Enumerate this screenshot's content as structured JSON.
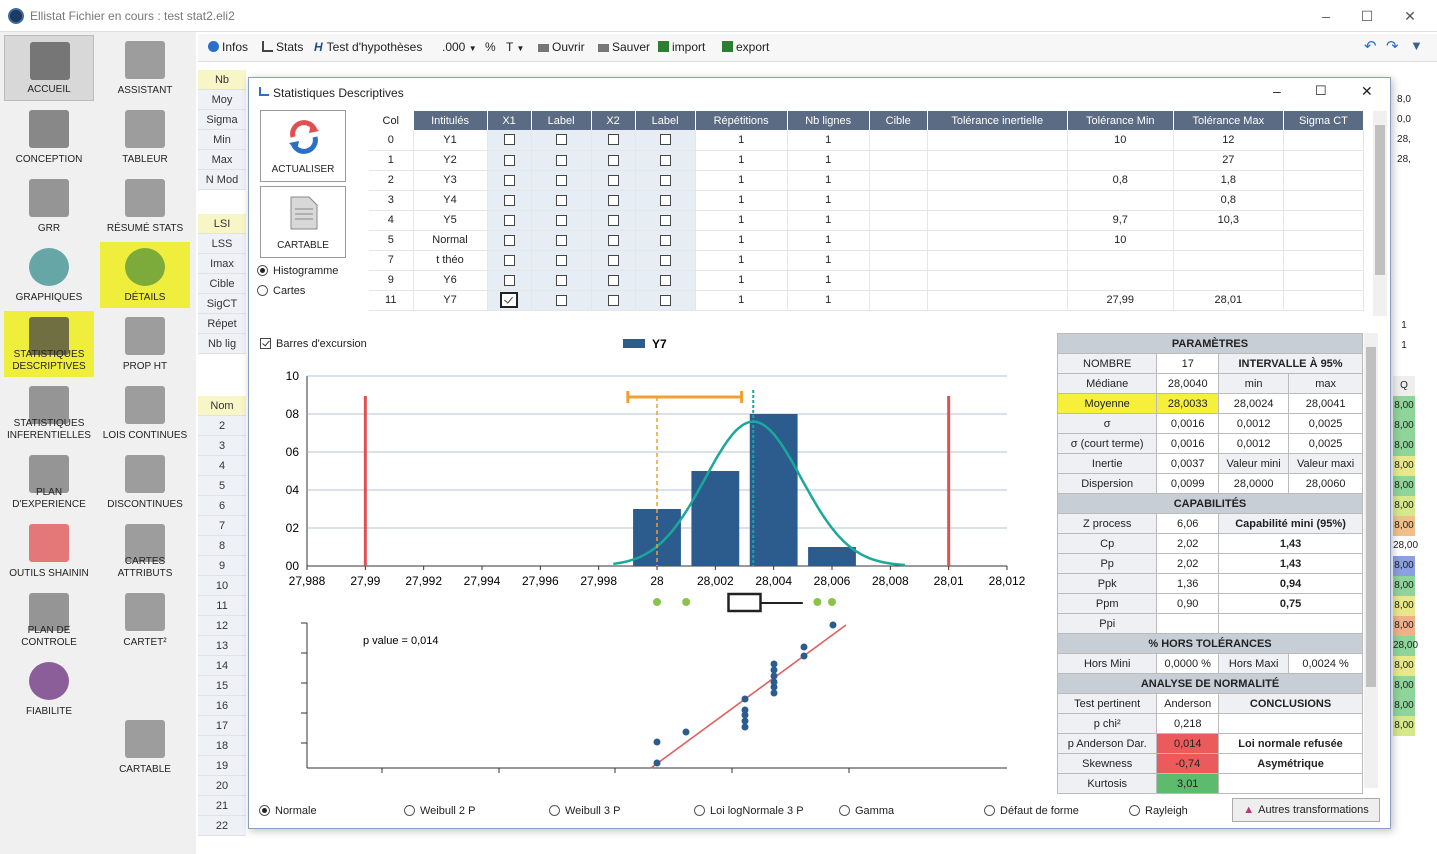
{
  "window": {
    "title": "Ellistat Fichier en cours : test stat2.eli2"
  },
  "sidebar": {
    "left": [
      {
        "label": "ACCUEIL",
        "icon": "home-icon"
      },
      {
        "label": "CONCEPTION",
        "icon": "conception-icon"
      },
      {
        "label": "GRR",
        "icon": "caliper-icon"
      },
      {
        "label": "GRAPHIQUES",
        "icon": "pie-chart-icon"
      },
      {
        "label": "STATISTIQUES DESCRIPTIVES",
        "icon": "bar-chart-icon"
      },
      {
        "label": "STATISTIQUES INFERENTIELLES",
        "icon": "cube-icon"
      },
      {
        "label": "PLAN D'EXPERIENCE",
        "icon": "hierarchy-icon"
      },
      {
        "label": "OUTILS SHAININ",
        "icon": "shainin-icon"
      },
      {
        "label": "PLAN DE CONTROLE",
        "icon": "control-plan-icon"
      },
      {
        "label": "FIABILITE",
        "icon": "check-icon"
      }
    ],
    "right": [
      {
        "label": "ASSISTANT",
        "icon": "question-icon"
      },
      {
        "label": "TABLEUR",
        "icon": "spreadsheet-icon"
      },
      {
        "label": "RÉSUMÉ STATS",
        "icon": "summary-icon"
      },
      {
        "label": "DÉTAILS",
        "icon": "magnifier-icon"
      },
      {
        "label": "PROP HT",
        "icon": "bell-curve-icon"
      },
      {
        "label": "LOIS CONTINUES",
        "icon": "distribution-icon"
      },
      {
        "label": "DISCONTINUES",
        "icon": "discrete-icon"
      },
      {
        "label": "CARTES ATTRIBUTS",
        "icon": "attributes-chart-icon"
      },
      {
        "label": "CARTET²",
        "icon": "control-chart-icon"
      },
      {
        "label": "CARTABLE",
        "icon": "document-icon"
      }
    ]
  },
  "toolbar": {
    "infos": "Infos",
    "stats": "Stats",
    "test": "Test d'hypothèses",
    "format": ".000",
    "percent": "%",
    "t": "T",
    "ouvrir": "Ouvrir",
    "sauver": "Sauver",
    "import": "import",
    "export": "export"
  },
  "sheet": {
    "row_headers_top": [
      "Nb",
      "Moy",
      "Sigma",
      "Min",
      "Max",
      "N Mod"
    ],
    "row_headers_mid": [
      "LSI",
      "LSS",
      "Imax",
      "Cible",
      "SigCT",
      "Répet",
      "Nb lig"
    ],
    "row_headers_nums": [
      "Nom",
      "2",
      "3",
      "4",
      "5",
      "6",
      "7",
      "8",
      "9",
      "10",
      "11",
      "12",
      "13",
      "14",
      "15",
      "16",
      "17",
      "18",
      "19",
      "20",
      "21",
      "22"
    ],
    "right_col_top": [
      "8,0",
      "0,0",
      "28,",
      "28,"
    ],
    "right_col_bottom": [
      "Q",
      "8,00",
      "8,00",
      "8,00",
      "8,00",
      "8,00",
      "8,00",
      "8,00",
      "28,00",
      "8,00",
      "8,00",
      "8,00",
      "8,00",
      "28,00",
      "8,00",
      "8,00",
      "8,00",
      "8,00"
    ],
    "right_col_mid": [
      "1",
      "1"
    ]
  },
  "dialog": {
    "title": "Statistiques Descriptives",
    "actualiser": "ACTUALISER",
    "cartable": "CARTABLE",
    "radio_histogramme": "Histogramme",
    "radio_cartes": "Cartes",
    "barres": "Barres d'excursion",
    "table": {
      "headers": [
        "Col",
        "Intitulés",
        "X1",
        "Label",
        "X2",
        "Label",
        "Répétitions",
        "Nb lignes",
        "Cible",
        "Tolérance inertielle",
        "Tolérance Min",
        "Tolérance Max",
        "Sigma CT"
      ],
      "rows": [
        {
          "col": "0",
          "name": "Y1",
          "rep": "1",
          "nb": "1",
          "tmin": "10",
          "tmax": "12",
          "x1": false
        },
        {
          "col": "1",
          "name": "Y2",
          "rep": "1",
          "nb": "1",
          "tmin": "",
          "tmax": "27",
          "x1": false
        },
        {
          "col": "2",
          "name": "Y3",
          "rep": "1",
          "nb": "1",
          "tmin": "0,8",
          "tmax": "1,8",
          "x1": false
        },
        {
          "col": "3",
          "name": "Y4",
          "rep": "1",
          "nb": "1",
          "tmin": "",
          "tmax": "0,8",
          "x1": false
        },
        {
          "col": "4",
          "name": "Y5",
          "rep": "1",
          "nb": "1",
          "tmin": "9,7",
          "tmax": "10,3",
          "x1": false
        },
        {
          "col": "5",
          "name": "Normal",
          "rep": "1",
          "nb": "1",
          "tmin": "10",
          "tmax": "",
          "x1": false
        },
        {
          "col": "7",
          "name": "t théo",
          "rep": "1",
          "nb": "1",
          "tmin": "",
          "tmax": "",
          "x1": false
        },
        {
          "col": "9",
          "name": "Y6",
          "rep": "1",
          "nb": "1",
          "tmin": "",
          "tmax": "",
          "x1": false
        },
        {
          "col": "11",
          "name": "Y7",
          "rep": "1",
          "nb": "1",
          "tmin": "27,99",
          "tmax": "28,01",
          "x1": true
        }
      ]
    },
    "distributions": [
      "Normale",
      "Weibull 2 P",
      "Weibull 3 P",
      "Loi logNormale 3 P",
      "Gamma",
      "Défaut de forme",
      "Rayleigh"
    ],
    "autres": "Autres transformations",
    "pvalue": "p value = 0,014"
  },
  "chart_data": {
    "type": "bar",
    "legend": "Y7",
    "x_ticks": [
      "27,988",
      "27,99",
      "27,992",
      "27,994",
      "27,996",
      "27,998",
      "28",
      "28,002",
      "28,004",
      "28,006",
      "28,008",
      "28,01",
      "28,012"
    ],
    "y_ticks": [
      "10",
      "08",
      "06",
      "04",
      "02",
      "00"
    ],
    "xlim": [
      27.988,
      28.012
    ],
    "ylim": [
      0,
      10
    ],
    "bins": [
      {
        "x": 28.0,
        "y": 3
      },
      {
        "x": 28.002,
        "y": 5
      },
      {
        "x": 28.004,
        "y": 8
      },
      {
        "x": 28.006,
        "y": 1
      }
    ],
    "tol_min": 27.99,
    "tol_max": 28.01,
    "mean": 28.0033,
    "excursion": [
      27.999,
      28.0029
    ],
    "colors": {
      "bar": "#2c5b8e",
      "curve": "#1aa89a",
      "limit": "#e05050",
      "excursion": "#f0a030",
      "dots": "#8bc34a"
    }
  },
  "params": {
    "parametres": "PARAMÈTRES",
    "nombre_lbl": "NOMBRE",
    "nombre": "17",
    "intervalle": "INTERVALLE À 95%",
    "mediane_lbl": "Médiane",
    "mediane": "28,0040",
    "min_lbl": "min",
    "max_lbl": "max",
    "moyenne_lbl": "Moyenne",
    "moyenne": "28,0033",
    "moy_min": "28,0024",
    "moy_max": "28,0041",
    "sigma_lbl": "σ",
    "sigma": "0,0016",
    "sigma_min": "0,0012",
    "sigma_max": "0,0025",
    "sigct_lbl": "σ (court terme)",
    "sigct": "0,0016",
    "sigct_min": "0,0012",
    "sigct_max": "0,0025",
    "inertie_lbl": "Inertie",
    "inertie": "0,0037",
    "valmin_lbl": "Valeur mini",
    "valmax_lbl": "Valeur maxi",
    "dispersion_lbl": "Dispersion",
    "dispersion": "0,0099",
    "valmin": "28,0000",
    "valmax": "28,0060",
    "capabilites": "CAPABILITÉS",
    "zprocess_lbl": "Z process",
    "zprocess": "6,06",
    "capmini": "Capabilité mini (95%)",
    "cp_lbl": "Cp",
    "cp": "2,02",
    "cp_min": "1,43",
    "pp_lbl": "Pp",
    "pp": "2,02",
    "pp_min": "1,43",
    "ppk_lbl": "Ppk",
    "ppk": "1,36",
    "ppk_min": "0,94",
    "ppm_lbl": "Ppm",
    "ppm": "0,90",
    "ppm_min": "0,75",
    "ppi_lbl": "Ppi",
    "hors": "% HORS TOLÉRANCES",
    "horsmini_lbl": "Hors Mini",
    "horsmini": "0,0000 %",
    "horsmaxi_lbl": "Hors Maxi",
    "horsmaxi": "0,0024 %",
    "normalite": "ANALYSE DE NORMALITÉ",
    "test_lbl": "Test pertinent",
    "test": "Anderson",
    "conclusions": "CONCLUSIONS",
    "chi_lbl": "p chi²",
    "chi": "0,218",
    "and_lbl": "p Anderson Dar.",
    "and": "0,014",
    "and_concl": "Loi normale refusée",
    "skew_lbl": "Skewness",
    "skew": "-0,74",
    "skew_concl": "Asymétrique",
    "kurt_lbl": "Kurtosis",
    "kurt": "3,01"
  }
}
